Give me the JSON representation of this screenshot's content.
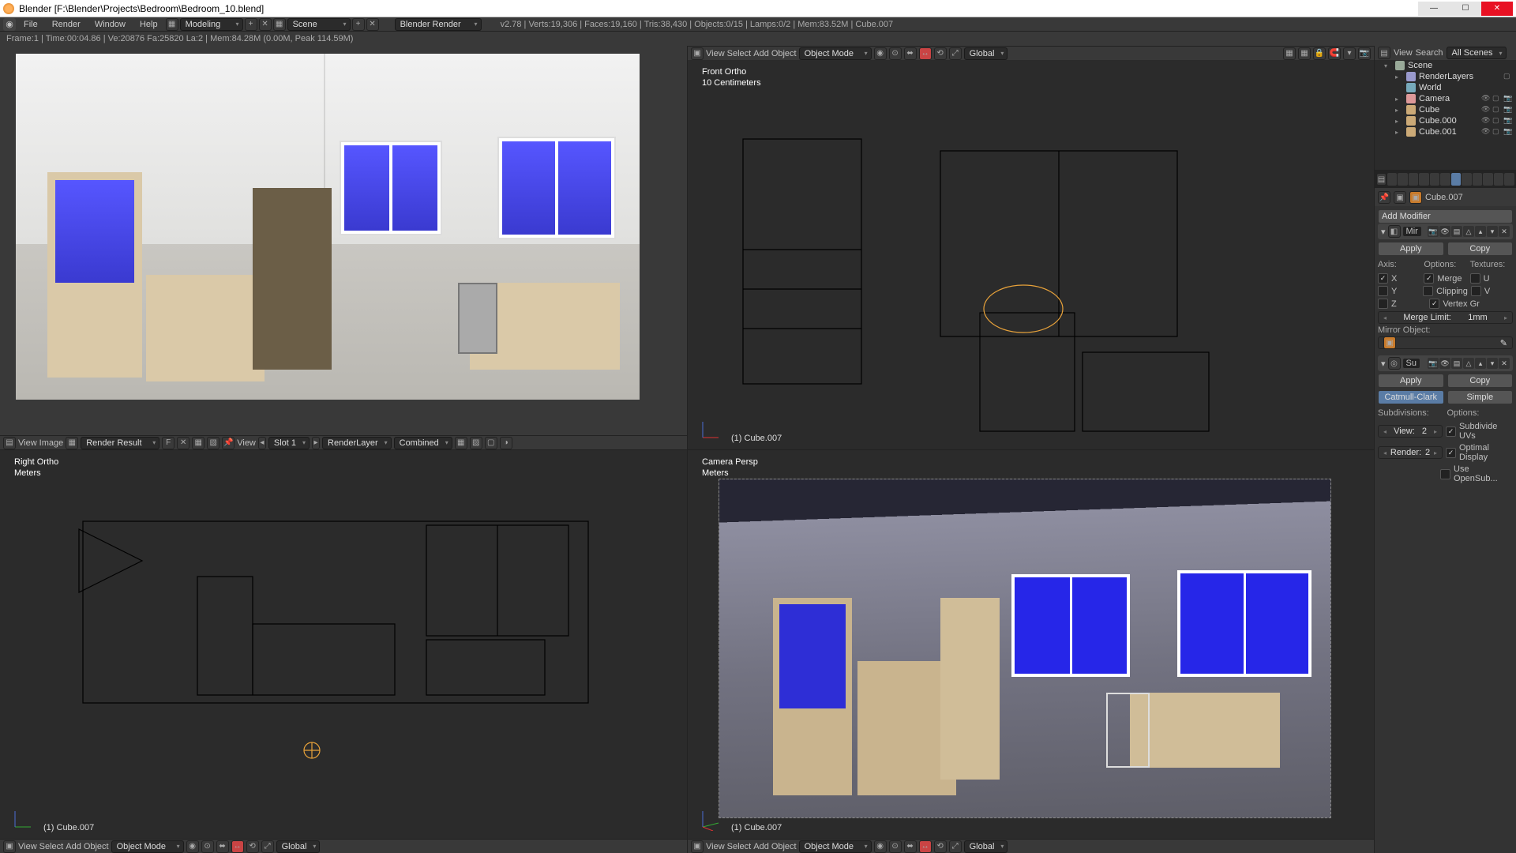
{
  "window": {
    "title": "Blender [F:\\Blender\\Projects\\Bedroom\\Bedroom_10.blend]"
  },
  "topbar": {
    "menus": [
      "File",
      "Render",
      "Window",
      "Help"
    ],
    "layout": "Modeling",
    "scene": "Scene",
    "renderer": "Blender Render",
    "stats": "v2.78 | Verts:19,306 | Faces:19,160 | Tris:38,430 | Objects:0/15 | Lamps:0/2 | Mem:83.52M | Cube.007"
  },
  "render_stats": "Frame:1 | Time:00:04.86 | Ve:20876 Fa:25820 La:2 | Mem:84.28M (0.00M, Peak 114.59M)",
  "image_editor": {
    "menus": [
      "View",
      "Image"
    ],
    "image": "Render Result",
    "pin": "F",
    "view2": "View",
    "slot": "Slot 1",
    "layer": "RenderLayer",
    "pass": "Combined"
  },
  "v3d": {
    "menus": [
      "View",
      "Select",
      "Add",
      "Object"
    ],
    "mode": "Object Mode",
    "orient": "Global",
    "front": {
      "title": "Front Ortho",
      "sub": "10 Centimeters",
      "obj": "(1) Cube.007"
    },
    "right": {
      "title": "Right Ortho",
      "sub": "Meters",
      "obj": "(1) Cube.007"
    },
    "camera": {
      "title": "Camera Persp",
      "sub": "Meters",
      "obj": "(1) Cube.007"
    }
  },
  "outliner": {
    "menus": [
      "View",
      "Search"
    ],
    "datablock": "All Scenes",
    "items": [
      {
        "name": "Scene",
        "type": "scene"
      },
      {
        "name": "RenderLayers",
        "type": "rl",
        "indent": 1
      },
      {
        "name": "World",
        "type": "world",
        "indent": 1
      },
      {
        "name": "Camera",
        "type": "cam",
        "indent": 1
      },
      {
        "name": "Cube",
        "type": "mesh",
        "indent": 1
      },
      {
        "name": "Cube.000",
        "type": "mesh",
        "indent": 1
      },
      {
        "name": "Cube.001",
        "type": "mesh",
        "indent": 1
      }
    ]
  },
  "props": {
    "context_object": "Cube.007",
    "add_modifier": "Add Modifier",
    "mirror": {
      "name": "Mir",
      "apply": "Apply",
      "copy": "Copy",
      "axis_label": "Axis:",
      "options_label": "Options:",
      "textures_label": "Textures:",
      "x": "X",
      "y": "Y",
      "z": "Z",
      "merge": "Merge",
      "clipping": "Clipping",
      "vertex": "Vertex Gr",
      "u": "U",
      "v": "V",
      "merge_limit_label": "Merge Limit:",
      "merge_limit_value": "1mm",
      "mirror_object": "Mirror Object:"
    },
    "subsurf": {
      "name": "Su",
      "apply": "Apply",
      "copy": "Copy",
      "catmull": "Catmull-Clark",
      "simple": "Simple",
      "subdivisions": "Subdivisions:",
      "options": "Options:",
      "view_label": "View:",
      "view_val": "2",
      "render_label": "Render:",
      "render_val": "2",
      "sub_uvs": "Subdivide UVs",
      "opt_display": "Optimal Display",
      "opensub": "Use OpenSub..."
    }
  }
}
